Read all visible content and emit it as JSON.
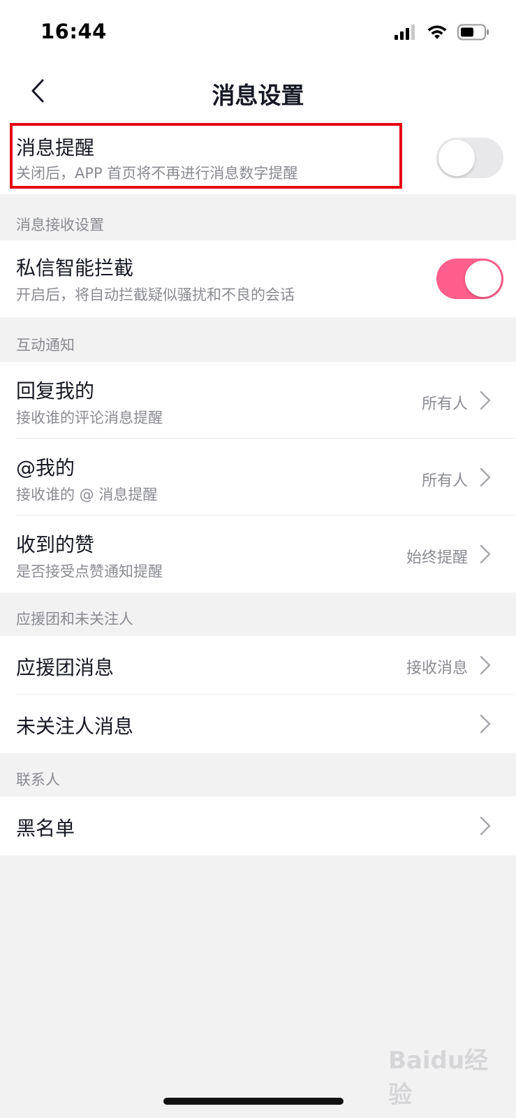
{
  "status": {
    "time": "16:44"
  },
  "nav": {
    "title": "消息设置"
  },
  "reminder": {
    "title": "消息提醒",
    "subtitle": "关闭后，APP 首页将不再进行消息数字提醒",
    "enabled": false
  },
  "sections": {
    "receive": "消息接收设置",
    "interaction": "互动通知",
    "fans": "应援团和未关注人",
    "contacts": "联系人"
  },
  "dm_filter": {
    "title": "私信智能拦截",
    "subtitle": "开启后，将自动拦截疑似骚扰和不良的会话",
    "enabled": true
  },
  "reply": {
    "title": "回复我的",
    "subtitle": "接收谁的评论消息提醒",
    "value": "所有人"
  },
  "mention": {
    "title": "@我的",
    "subtitle": "接收谁的 @ 消息提醒",
    "value": "所有人"
  },
  "likes": {
    "title": "收到的赞",
    "subtitle": "是否接受点赞通知提醒",
    "value": "始终提醒"
  },
  "fan_group": {
    "title": "应援团消息",
    "value": "接收消息"
  },
  "stranger": {
    "title": "未关注人消息"
  },
  "blacklist": {
    "title": "黑名单"
  },
  "watermark": {
    "text": "Baidu经验"
  },
  "colors": {
    "toggle_on": "#fe5f8c",
    "toggle_off": "#e8e8ea",
    "highlight": "#e60012"
  },
  "icons": {
    "back": "chevron-left-icon",
    "row": "chevron-right-icon"
  }
}
